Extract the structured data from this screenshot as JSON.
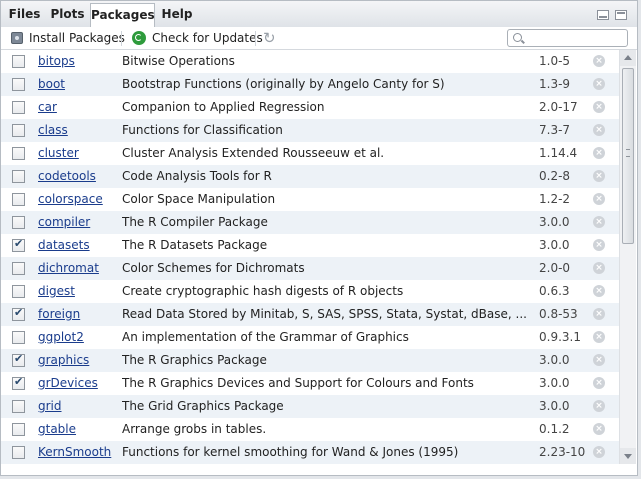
{
  "tabs": [
    "Files",
    "Plots",
    "Packages",
    "Help"
  ],
  "toolbar": {
    "install_label": "Install Packages",
    "update_label": "Check for Updates",
    "search_placeholder": ""
  },
  "packages": [
    {
      "name": "bitops",
      "description": "Bitwise Operations",
      "version": "1.0-5",
      "checked": false
    },
    {
      "name": "boot",
      "description": "Bootstrap Functions (originally by Angelo Canty for S)",
      "version": "1.3-9",
      "checked": false
    },
    {
      "name": "car",
      "description": "Companion to Applied Regression",
      "version": "2.0-17",
      "checked": false
    },
    {
      "name": "class",
      "description": "Functions for Classification",
      "version": "7.3-7",
      "checked": false
    },
    {
      "name": "cluster",
      "description": "Cluster Analysis Extended Rousseeuw et al.",
      "version": "1.14.4",
      "checked": false
    },
    {
      "name": "codetools",
      "description": "Code Analysis Tools for R",
      "version": "0.2-8",
      "checked": false
    },
    {
      "name": "colorspace",
      "description": "Color Space Manipulation",
      "version": "1.2-2",
      "checked": false
    },
    {
      "name": "compiler",
      "description": "The R Compiler Package",
      "version": "3.0.0",
      "checked": false
    },
    {
      "name": "datasets",
      "description": "The R Datasets Package",
      "version": "3.0.0",
      "checked": true
    },
    {
      "name": "dichromat",
      "description": "Color Schemes for Dichromats",
      "version": "2.0-0",
      "checked": false
    },
    {
      "name": "digest",
      "description": "Create cryptographic hash digests of R objects",
      "version": "0.6.3",
      "checked": false
    },
    {
      "name": "foreign",
      "description": "Read Data Stored by Minitab, S, SAS, SPSS, Stata, Systat, dBase, ...",
      "version": "0.8-53",
      "checked": true
    },
    {
      "name": "ggplot2",
      "description": "An implementation of the Grammar of Graphics",
      "version": "0.9.3.1",
      "checked": false
    },
    {
      "name": "graphics",
      "description": "The R Graphics Package",
      "version": "3.0.0",
      "checked": true
    },
    {
      "name": "grDevices",
      "description": "The R Graphics Devices and Support for Colours and Fonts",
      "version": "3.0.0",
      "checked": true
    },
    {
      "name": "grid",
      "description": "The Grid Graphics Package",
      "version": "3.0.0",
      "checked": false
    },
    {
      "name": "gtable",
      "description": "Arrange grobs in tables.",
      "version": "0.1.2",
      "checked": false
    },
    {
      "name": "KernSmooth",
      "description": "Functions for kernel smoothing for Wand & Jones (1995)",
      "version": "2.23-10",
      "checked": false
    }
  ],
  "colors": {
    "link": "#1a3c8c",
    "row_alt": "#edf2f7",
    "update_icon": "#2e9b3c"
  }
}
